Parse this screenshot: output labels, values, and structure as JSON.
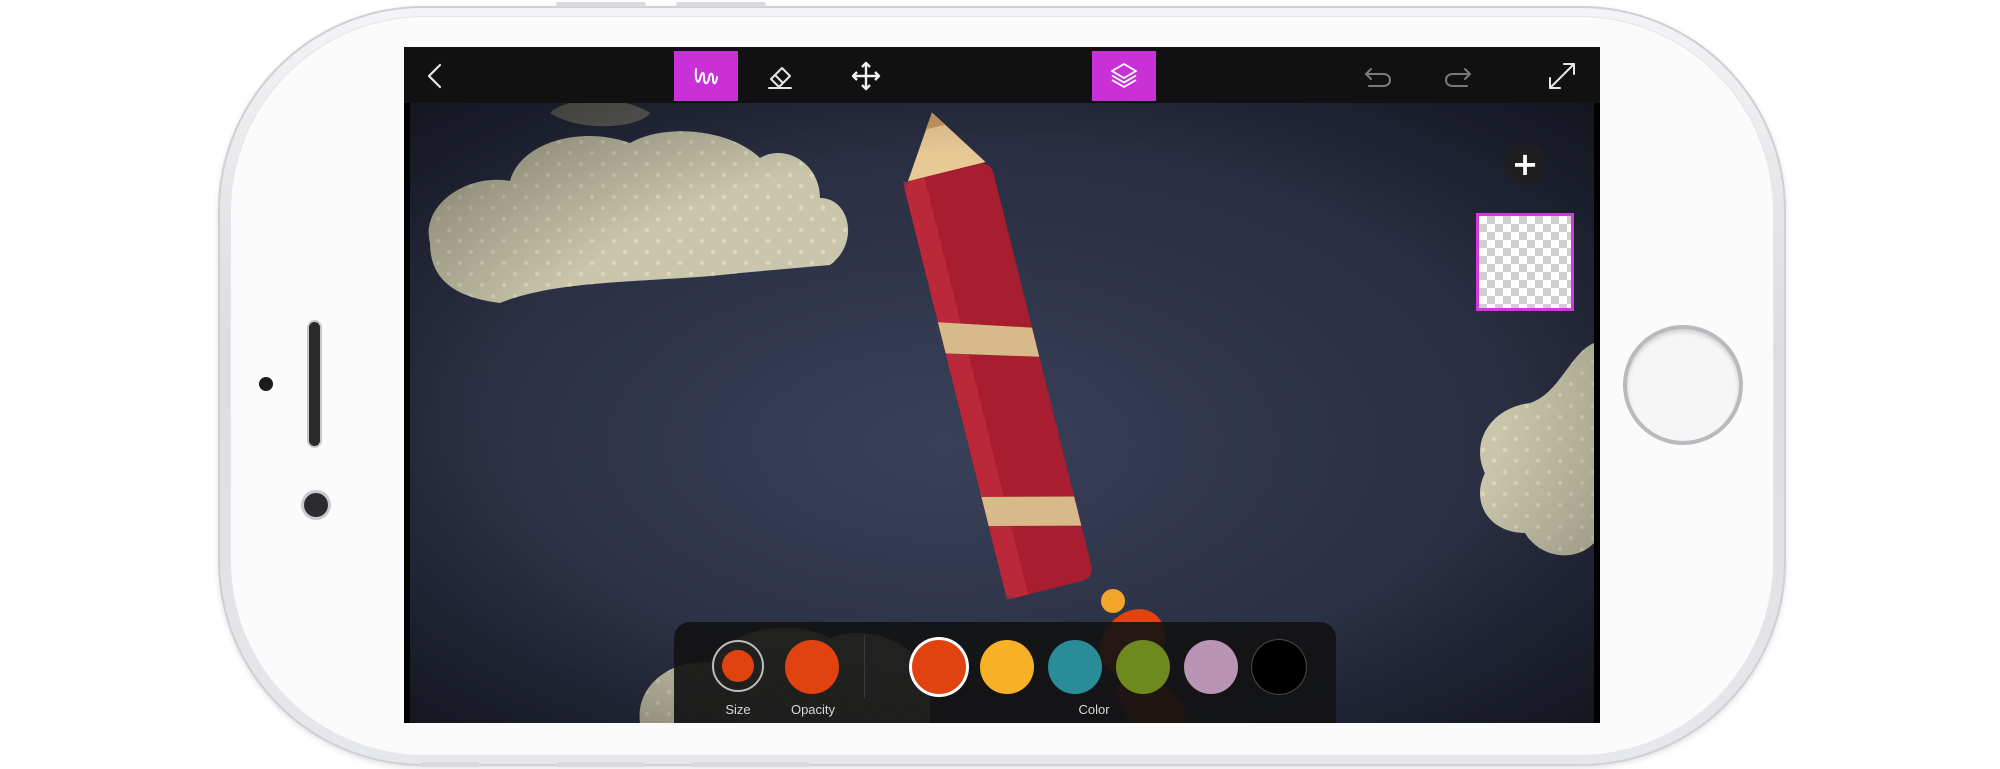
{
  "colors": {
    "accent": "#c931d6",
    "toolbar_bg": "#111111",
    "brush_color": "#e0430f"
  },
  "toolbar": {
    "back_icon": "chevron-left-icon",
    "brush_icon": "brush-squiggle-icon",
    "eraser_icon": "eraser-icon",
    "move_icon": "move-arrows-icon",
    "layers_icon": "layers-icon",
    "undo_icon": "undo-icon",
    "redo_icon": "redo-icon",
    "fullscreen_icon": "expand-icon"
  },
  "layers": {
    "add_icon": "plus-icon",
    "add_label": "+"
  },
  "palette": {
    "size_label": "Size",
    "opacity_label": "Opacity",
    "color_label": "Color",
    "swatches": [
      "#e0430f",
      "#f6b126",
      "#2a8c98",
      "#6e8a1f",
      "#b994b5",
      "#000000"
    ],
    "selected_index": 0
  }
}
